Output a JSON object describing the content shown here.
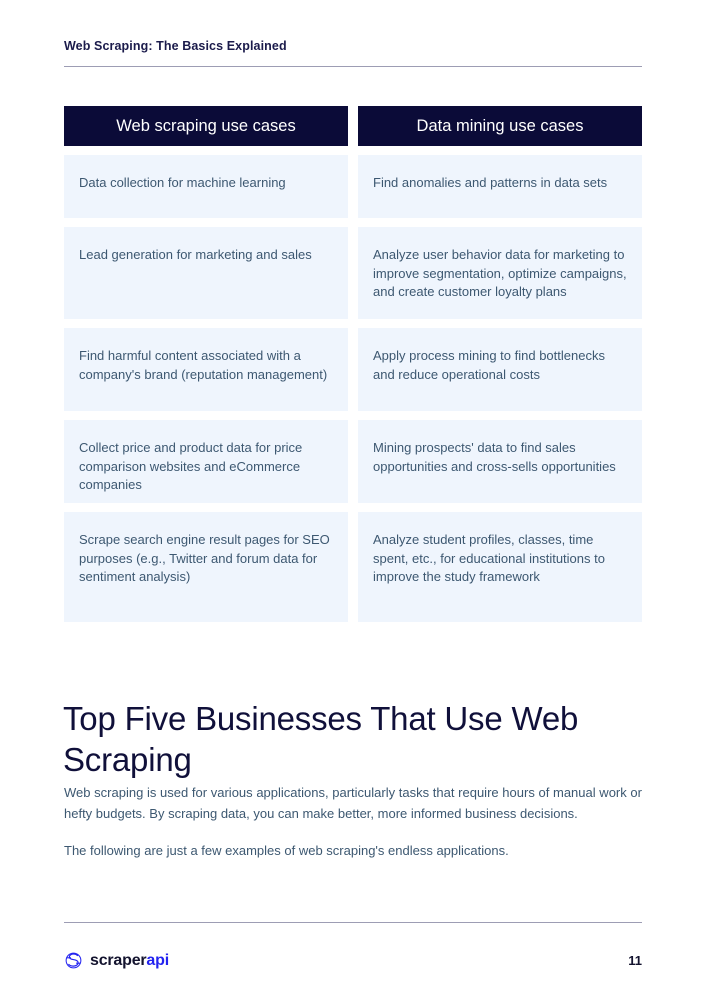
{
  "header": {
    "running_title": "Web Scraping: The Basics Explained"
  },
  "table": {
    "columns": [
      {
        "header": "Web scraping use cases",
        "cells": [
          "Data collection for machine learning",
          "Lead generation for marketing and sales",
          "Find harmful content associated with a company's brand (reputation management)",
          "Collect price and product data for price comparison websites and eCommerce companies",
          "Scrape search engine result pages for SEO purposes (e.g., Twitter and forum data for sentiment analysis)"
        ]
      },
      {
        "header": "Data mining use cases",
        "cells": [
          "Find anomalies and patterns in data sets",
          "Analyze user behavior data for marketing to improve segmentation, optimize campaigns, and create customer loyalty plans",
          "Apply process mining to find bottlenecks and reduce operational costs",
          "Mining prospects' data to find sales opportunities and cross-sells opportunities",
          "Analyze student profiles, classes, time spent, etc., for educational institutions to improve the study framework"
        ]
      }
    ]
  },
  "section": {
    "heading": "Top Five Businesses That Use Web Scraping",
    "paragraph_1": "Web scraping is used for various applications, particularly tasks that require hours of manual work or hefty budgets. By scraping data, you can make better, more informed business decisions.",
    "paragraph_2": "The following are just a few examples of web scraping's endless applications."
  },
  "footer": {
    "brand_primary": "scraper",
    "brand_accent": "api",
    "page_number": "11"
  },
  "colors": {
    "header_bar": "#0b0b38",
    "cell_background": "#eff5fd",
    "body_text": "#3d5871",
    "heading_text": "#10103a",
    "rule": "#9d9db4",
    "brand_accent": "#2323f0"
  }
}
